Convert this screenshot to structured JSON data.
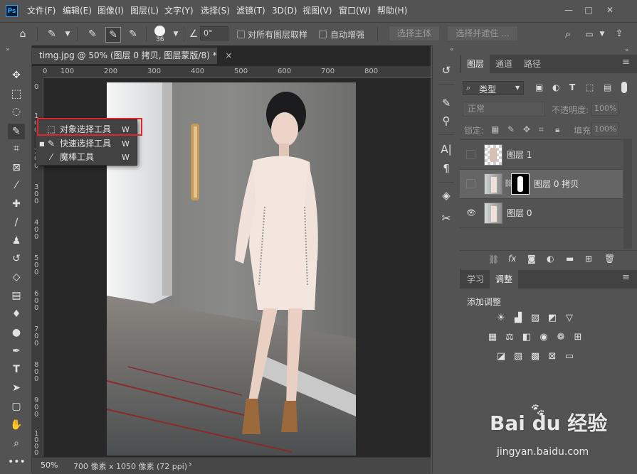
{
  "menubar": {
    "items": [
      "文件(F)",
      "编辑(E)",
      "图像(I)",
      "图层(L)",
      "文字(Y)",
      "选择(S)",
      "滤镜(T)",
      "3D(D)",
      "视图(V)",
      "窗口(W)",
      "帮助(H)"
    ],
    "logo": "Ps",
    "minimize": "—",
    "maximize": "□",
    "close": "✕"
  },
  "options": {
    "brush_size": "36",
    "angle": "0°",
    "sample_all_layers": "对所有图层取样",
    "auto_enhance": "自动增强",
    "select_subject": "选择主体",
    "select_and_mask": "选择并遮住 ..."
  },
  "document": {
    "tab_title": "timg.jpg @ 50% (图层 0 拷贝, 图层蒙版/8) *",
    "tab_close": "×",
    "zoom": "50%",
    "doc_info": "700 像素 x 1050 像素 (72 ppi)",
    "status_arrow": "›",
    "ruler_top_ticks": [
      "0",
      "100",
      "200",
      "300",
      "400",
      "500",
      "600",
      "700",
      "800"
    ],
    "ruler_left_ticks": [
      "0",
      "1\n0\n0",
      "2\n0\n0",
      "3\n0\n0",
      "4\n0\n0",
      "5\n0\n0",
      "6\n0\n0",
      "7\n0\n0",
      "8\n0\n0",
      "9\n0\n0",
      "1\n0\n0\n0"
    ]
  },
  "flyout": {
    "items": [
      {
        "label": "对象选择工具",
        "shortcut": "W"
      },
      {
        "label": "快速选择工具",
        "shortcut": "W"
      },
      {
        "label": "魔棒工具",
        "shortcut": "W"
      }
    ]
  },
  "layers_panel": {
    "tabs": [
      "图层",
      "通道",
      "路径"
    ],
    "filter_label": "类型",
    "blend_mode": "正常",
    "opacity_label": "不透明度:",
    "opacity_value": "100%",
    "lock_label": "锁定:",
    "fill_label": "填充:",
    "fill_value": "100%",
    "layers": [
      {
        "name": "图层 1",
        "visible": false
      },
      {
        "name": "图层 0 拷贝",
        "visible": false
      },
      {
        "name": "图层 0",
        "visible": true
      }
    ]
  },
  "adjust_panel": {
    "tabs": [
      "学习",
      "调整"
    ],
    "title": "添加调整"
  },
  "watermark": {
    "brand": "Bai du 经验",
    "url": "jingyan.baidu.com"
  },
  "colors": {
    "accent_red": "#e0262a",
    "ps_blue": "#31a8ff"
  }
}
